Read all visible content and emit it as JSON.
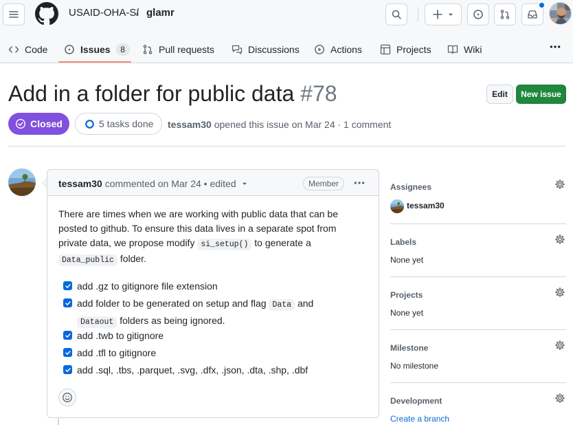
{
  "header": {
    "owner": "USAID-OHA-SI",
    "separator": "/",
    "repo": "glamr",
    "icons": [
      "hamburger-icon",
      "github-logo-icon",
      "search-icon",
      "plus-icon",
      "issue-icon",
      "pull-request-icon",
      "inbox-icon"
    ]
  },
  "tabs": [
    {
      "label": "Code",
      "icon": "code-icon"
    },
    {
      "label": "Issues",
      "icon": "issue-opened-icon",
      "count": "8"
    },
    {
      "label": "Pull requests",
      "icon": "git-pull-request-icon"
    },
    {
      "label": "Discussions",
      "icon": "comment-discussion-icon"
    },
    {
      "label": "Actions",
      "icon": "play-icon"
    },
    {
      "label": "Projects",
      "icon": "table-icon"
    },
    {
      "label": "Wiki",
      "icon": "book-icon"
    }
  ],
  "issue": {
    "title": "Add in a folder for public data",
    "number": "#78",
    "edit_label": "Edit",
    "new_issue_label": "New issue",
    "state": "Closed",
    "tasks": "5 tasks done",
    "author": "tessam30",
    "meta_rest": "opened this issue on Mar 24 · 1 comment"
  },
  "comment": {
    "author": "tessam30",
    "meta": "commented on Mar 24 • edited",
    "role": "Member",
    "body_1": "There are times when we are working with public data that can be",
    "body_2": "posted to github. To ensure this data lives in a separate spot from",
    "body_3a": "private data, we propose modify",
    "code_1": "si_setup()",
    "body_3b": "to generate a",
    "code_2": "Data_public",
    "body_4": "folder.",
    "tasks": {
      "t1": "add .gz to gitignore file extension",
      "t2a": "add folder to be generated on setup and flag",
      "t2_code1": "Data",
      "t2b": "and",
      "t2_code2": "Dataout",
      "t2c": "folders as being ignored.",
      "t3": "add .twb to gitignore",
      "t4": "add .tfl to gitignore",
      "t5": "add .sql, .tbs, .parquet, .svg, .dfx, .json, .dta, .shp, .dbf"
    }
  },
  "sidebar": {
    "assignees": {
      "heading": "Assignees",
      "value": "tessam30"
    },
    "labels": {
      "heading": "Labels",
      "value": "None yet"
    },
    "projects": {
      "heading": "Projects",
      "value": "None yet"
    },
    "milestone": {
      "heading": "Milestone",
      "value": "No milestone"
    },
    "development": {
      "heading": "Development",
      "value": "Create a branch"
    }
  },
  "colors": {
    "closed": "#8250df",
    "primary": "#1f883d",
    "link": "#0969da",
    "tab_underline": "#fd8c73"
  }
}
